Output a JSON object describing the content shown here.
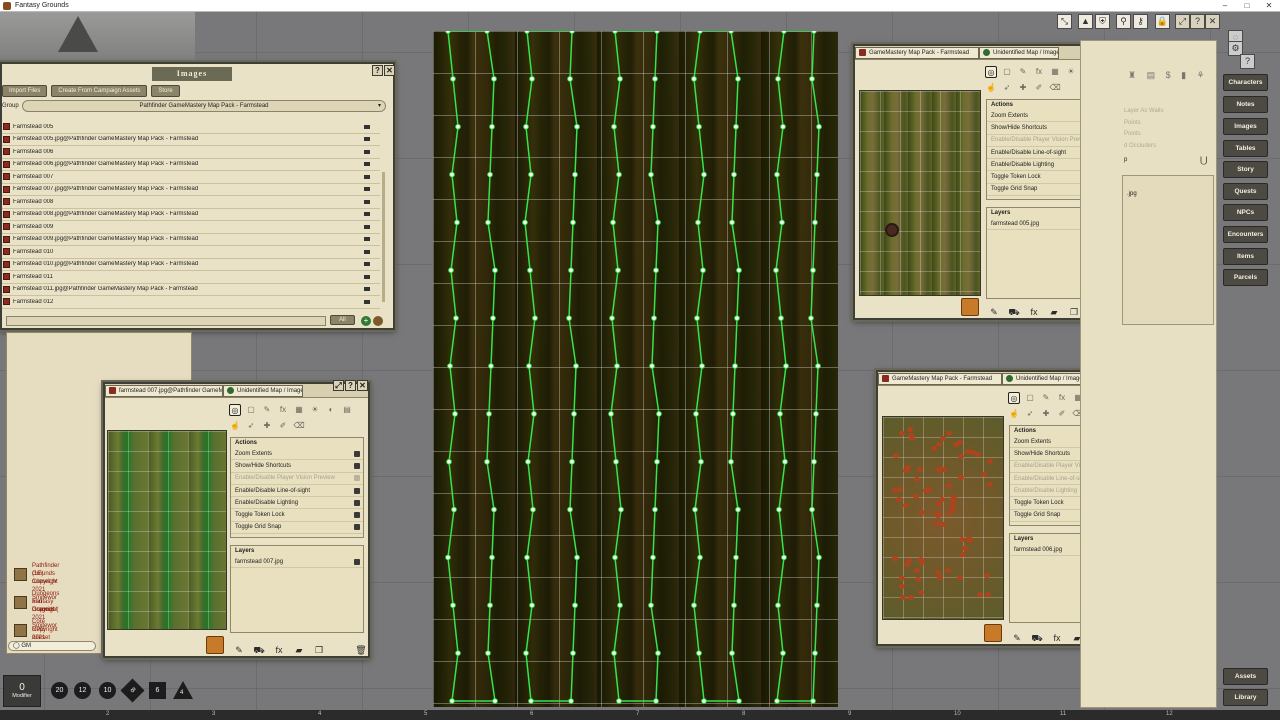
{
  "app": {
    "title": "Fantasy Grounds"
  },
  "window_controls": {
    "minimize": "–",
    "maximize": "□",
    "close": "✕"
  },
  "images_window": {
    "title": "Images",
    "help": "?",
    "close": "✕",
    "buttons": [
      "Import Files",
      "Create From Campaign Assets",
      "Store"
    ],
    "group_label": "Group",
    "group_value": "Pathfinder GameMastery Map Pack - Farmstead",
    "items": [
      "Farmstead 005",
      "Farmstead 005.jpg@Pathfinder GameMastery Map Pack - Farmstead",
      "Farmstead 006",
      "Farmstead 006.jpg@Pathfinder GameMastery Map Pack - Farmstead",
      "Farmstead 007",
      "Farmstead 007.jpg@Pathfinder GameMastery Map Pack - Farmstead",
      "Farmstead 008",
      "Farmstead 008.jpg@Pathfinder GameMastery Map Pack - Farmstead",
      "Farmstead 009",
      "Farmstead 009.jpg@Pathfinder GameMastery Map Pack - Farmstead",
      "Farmstead 010",
      "Farmstead 010.jpg@Pathfinder GameMastery Map Pack - Farmstead",
      "Farmstead 011",
      "Farmstead 011.jpg@Pathfinder GameMastery Map Pack - Farmstead",
      "Farmstead 012"
    ],
    "filter_all": "All"
  },
  "image_window_a": {
    "tab1": "GameMastery Map Pack - Farmstead",
    "tab2": "Unidentified Map / Image",
    "actions_header": "Actions",
    "actions": [
      {
        "label": "Zoom Extents",
        "enabled": true
      },
      {
        "label": "Show/Hide Shortcuts",
        "enabled": true
      },
      {
        "label": "Enable/Disable Player Vision Preview",
        "enabled": false
      },
      {
        "label": "Enable/Disable Line-of-sight",
        "enabled": true
      },
      {
        "label": "Enable/Disable Lighting",
        "enabled": true
      },
      {
        "label": "Toggle Token Lock",
        "enabled": true
      },
      {
        "label": "Toggle Grid Snap",
        "enabled": true
      }
    ],
    "layers_header": "Layers",
    "layer": "farmstead 005.jpg"
  },
  "image_window_b": {
    "tab1": "farmstead 007.jpg@Pathfinder GameMastery Map Pack - Farmstead",
    "tab2": "Unidentified Map / Image",
    "actions_header": "Actions",
    "actions": [
      {
        "label": "Zoom Extents",
        "enabled": true
      },
      {
        "label": "Show/Hide Shortcuts",
        "enabled": true
      },
      {
        "label": "Enable/Disable Player Vision Preview",
        "enabled": false
      },
      {
        "label": "Enable/Disable Line-of-sight",
        "enabled": true
      },
      {
        "label": "Enable/Disable Lighting",
        "enabled": true
      },
      {
        "label": "Toggle Token Lock",
        "enabled": true
      },
      {
        "label": "Toggle Grid Snap",
        "enabled": true
      }
    ],
    "layers_header": "Layers",
    "layer": "farmstead 007.jpg"
  },
  "image_window_c": {
    "tab1": "GameMastery Map Pack - Farmstead",
    "tab2": "Unidentified Map / Image",
    "actions_header": "Actions",
    "actions": [
      {
        "label": "Zoom Extents",
        "enabled": true
      },
      {
        "label": "Show/Hide Shortcuts",
        "enabled": true
      },
      {
        "label": "Enable/Disable Player Vision Preview",
        "enabled": false
      },
      {
        "label": "Enable/Disable Line-of-sight",
        "enabled": false
      },
      {
        "label": "Enable/Disable Lighting",
        "enabled": false
      },
      {
        "label": "Toggle Token Lock",
        "enabled": true
      },
      {
        "label": "Toggle Grid Snap",
        "enabled": true
      }
    ],
    "layers_header": "Layers",
    "layer": "farmstead 006.jpg"
  },
  "background_panel": {
    "items": [
      "Layer As Walls",
      "Points",
      "Points",
      "d Occluders"
    ],
    "partial_label": "p",
    "partial_file": ".jpg"
  },
  "sidebar": {
    "buttons": [
      "Characters",
      "Notes",
      "Images",
      "Tables",
      "Story",
      "Quests",
      "NPCs",
      "Encounters",
      "Items",
      "Parcels"
    ],
    "bottom_buttons": [
      "Assets",
      "Library"
    ]
  },
  "chat": {
    "entries": [
      {
        "line1": "Pathfinder (1E) ruleset (v",
        "line2": "Grounds",
        "line3": "Copyright 2021 Smitewor"
      },
      {
        "line1": "Dungeons and Dragons (",
        "line2": "Fantasy Grounds",
        "line3": "Copyright 2021 Smitewor"
      },
      {
        "line1": "Core RPG ruleset (v2021-",
        "line2": "Copyright 2021 Smitewor",
        "line3": ""
      }
    ],
    "speaker": "GM"
  },
  "modifier": {
    "value": "0",
    "label": "Modifier"
  },
  "dice": [
    "20",
    "12",
    "10",
    "8",
    "6",
    "4"
  ],
  "ruler_marks": [
    "2",
    "3",
    "4",
    "5",
    "6",
    "7",
    "8",
    "9",
    "10",
    "11",
    "12"
  ]
}
